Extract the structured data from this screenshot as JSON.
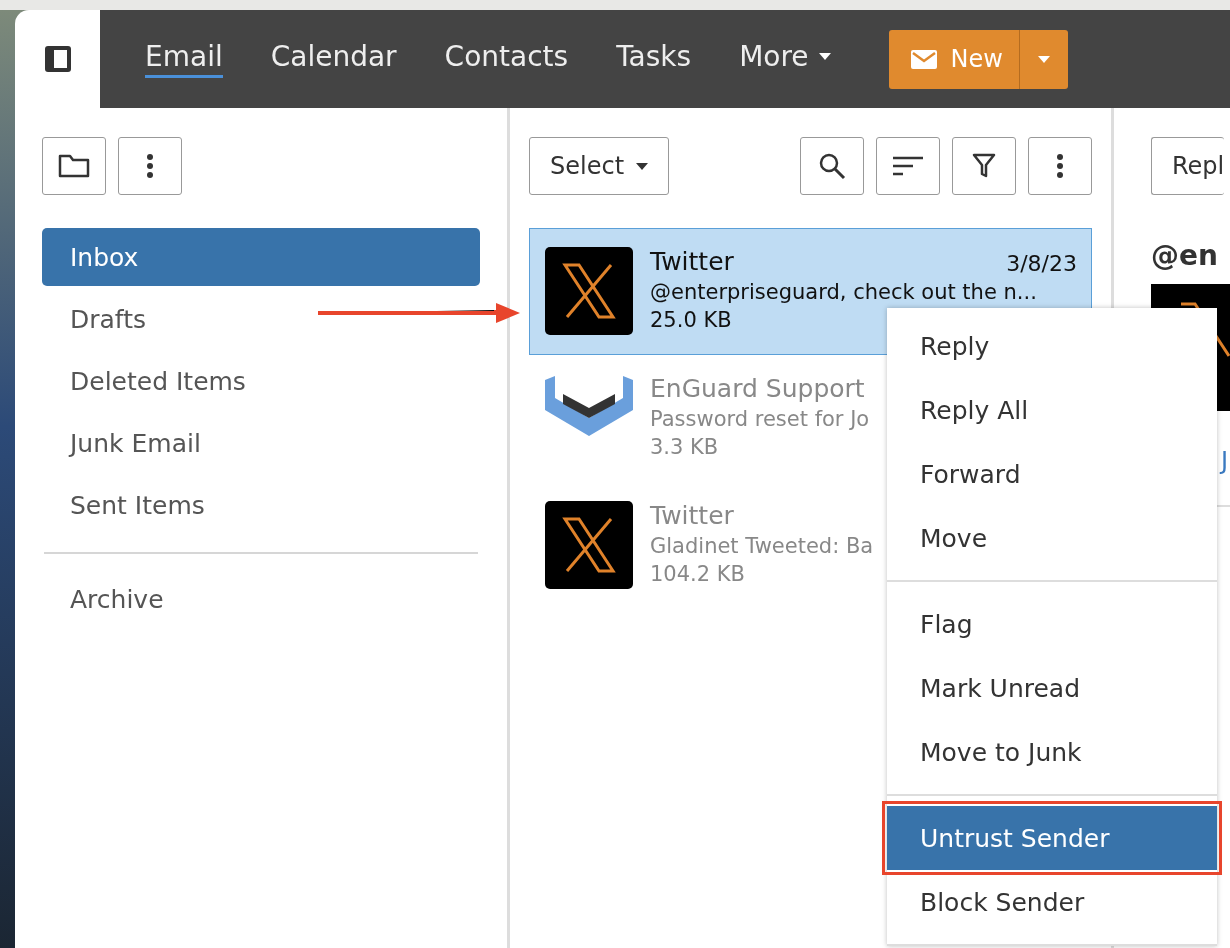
{
  "nav": {
    "tabs": [
      {
        "label": "Email",
        "selected": true
      },
      {
        "label": "Calendar",
        "selected": false
      },
      {
        "label": "Contacts",
        "selected": false
      },
      {
        "label": "Tasks",
        "selected": false
      },
      {
        "label": "More",
        "selected": false,
        "dropdown": true
      }
    ],
    "new_button": {
      "label": "New"
    }
  },
  "folders": {
    "items": [
      {
        "label": "Inbox",
        "selected": true
      },
      {
        "label": "Drafts",
        "selected": false
      },
      {
        "label": "Deleted Items",
        "selected": false
      },
      {
        "label": "Junk Email",
        "selected": false
      },
      {
        "label": "Sent Items",
        "selected": false
      }
    ],
    "extra": [
      {
        "label": "Archive",
        "selected": false
      }
    ]
  },
  "message_list": {
    "select_button": "Select",
    "messages": [
      {
        "sender": "Twitter",
        "date": "3/8/23",
        "preview": "@enterpriseguard, check out the n...",
        "size": "25.0 KB",
        "kind": "x",
        "selected": true
      },
      {
        "sender": "EnGuard Support",
        "preview": "Password reset for Jo",
        "size": "3.3 KB",
        "kind": "shield",
        "selected": false
      },
      {
        "sender": "Twitter",
        "preview": "Gladinet Tweeted: Ba",
        "size": "104.2 KB",
        "kind": "x",
        "selected": false
      }
    ]
  },
  "reading_pane": {
    "button": "Repl",
    "heading": "@en",
    "link": "J"
  },
  "context_menu": {
    "groups": [
      [
        {
          "label": "Reply",
          "selected": false,
          "outlined": false
        },
        {
          "label": "Reply All",
          "selected": false,
          "outlined": false
        },
        {
          "label": "Forward",
          "selected": false,
          "outlined": false
        },
        {
          "label": "Move",
          "selected": false,
          "outlined": false
        }
      ],
      [
        {
          "label": "Flag",
          "selected": false,
          "outlined": false
        },
        {
          "label": "Mark Unread",
          "selected": false,
          "outlined": false
        },
        {
          "label": "Move to Junk",
          "selected": false,
          "outlined": false
        }
      ],
      [
        {
          "label": "Untrust Sender",
          "selected": true,
          "outlined": true
        },
        {
          "label": "Block Sender",
          "selected": false,
          "outlined": false
        }
      ]
    ]
  },
  "annotations": [
    {
      "kind": "arrow"
    }
  ]
}
